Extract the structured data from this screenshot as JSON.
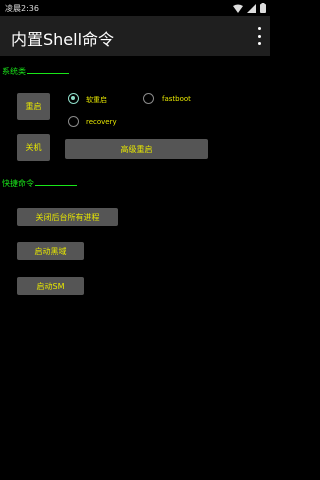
{
  "status_bar": {
    "time": "凌晨2:36"
  },
  "app_bar": {
    "title": "内置Shell命令"
  },
  "system": {
    "section_label": "系统类",
    "reboot_button": "重启",
    "shutdown_button": "关机",
    "radio_options": [
      {
        "label": "软重启",
        "checked": true
      },
      {
        "label": "fastboot",
        "checked": false
      },
      {
        "label": "recovery",
        "checked": false
      }
    ],
    "advanced_reboot_button": "高级重启"
  },
  "shortcut": {
    "section_label": "快捷命令",
    "kill_background_button": "关闭后台所有进程",
    "start_black_domain_button": "启动黑域",
    "start_sm_button": "启动SM"
  },
  "colors": {
    "accent_text": "#e8e800",
    "section": "#19e619",
    "radio_checked": "#8fdcc8",
    "button_bg": "#555555"
  }
}
